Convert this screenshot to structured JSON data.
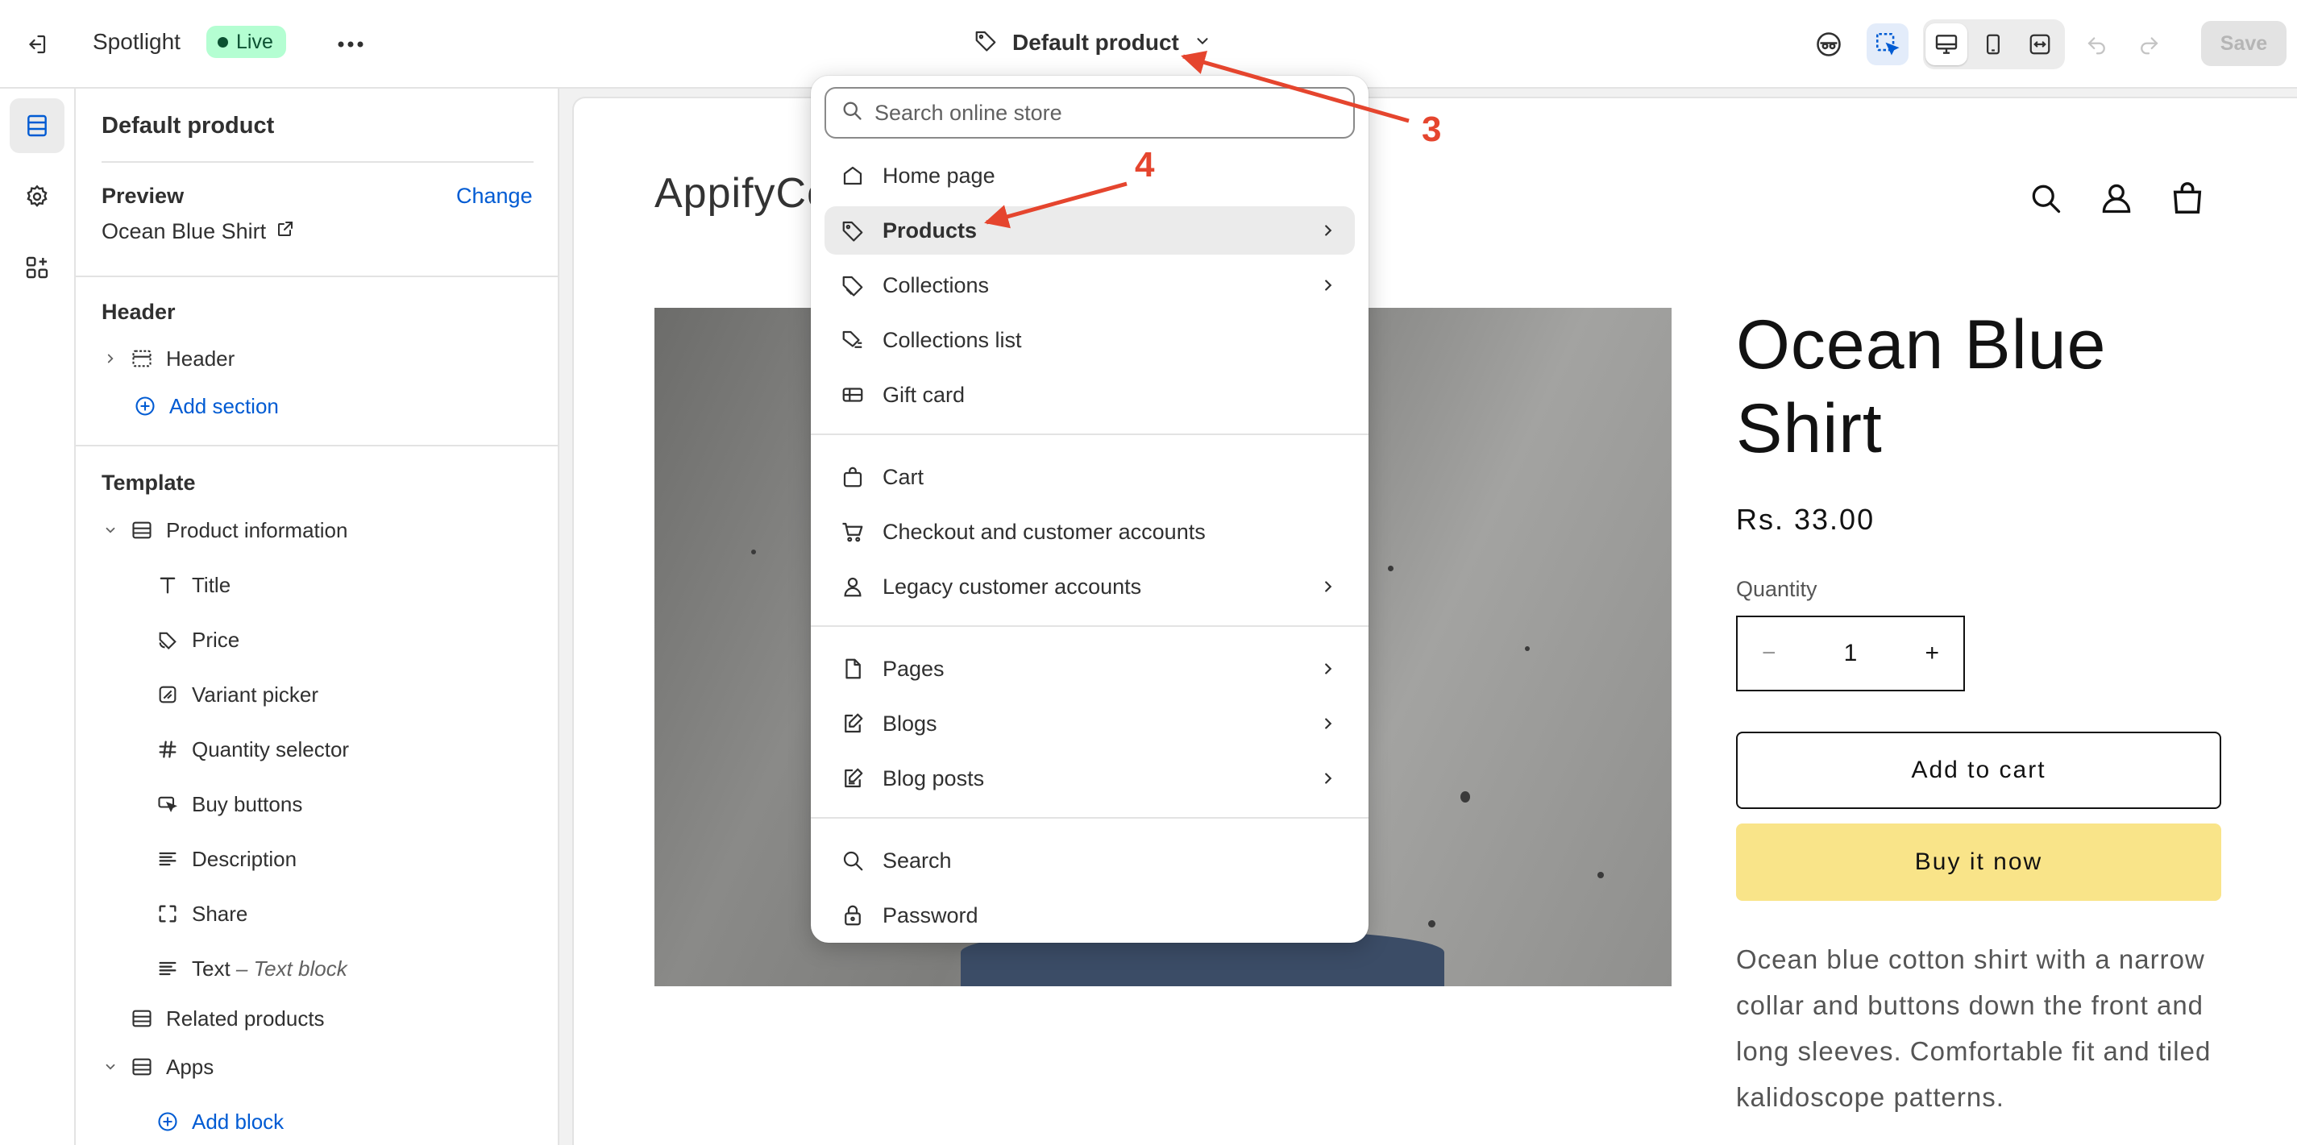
{
  "topbar": {
    "theme_name": "Spotlight",
    "live_label": "Live",
    "template_label": "Default product",
    "save_label": "Save"
  },
  "sidebar": {
    "title": "Default product",
    "preview_label": "Preview",
    "change_label": "Change",
    "preview_product": "Ocean Blue Shirt",
    "header_heading": "Header",
    "header_item": "Header",
    "add_section": "Add section",
    "template_heading": "Template",
    "product_information": "Product information",
    "blocks": {
      "title": "Title",
      "price": "Price",
      "variant_picker": "Variant picker",
      "quantity_selector": "Quantity selector",
      "buy_buttons": "Buy buttons",
      "description": "Description",
      "share": "Share",
      "text": "Text",
      "text_suffix": "– Text block"
    },
    "related_products": "Related products",
    "apps": "Apps",
    "add_block": "Add block"
  },
  "dropdown": {
    "search_placeholder": "Search online store",
    "items": [
      {
        "label": "Home page"
      },
      {
        "label": "Products"
      },
      {
        "label": "Collections"
      },
      {
        "label": "Collections list"
      },
      {
        "label": "Gift card"
      },
      {
        "label": "Cart"
      },
      {
        "label": "Checkout and customer accounts"
      },
      {
        "label": "Legacy customer accounts"
      },
      {
        "label": "Pages"
      },
      {
        "label": "Blogs"
      },
      {
        "label": "Blog posts"
      },
      {
        "label": "Search"
      },
      {
        "label": "Password"
      }
    ]
  },
  "store": {
    "logo": "AppifyCo",
    "product_title": "Ocean Blue Shirt",
    "price": "Rs. 33.00",
    "quantity_label": "Quantity",
    "quantity_value": "1",
    "qty_minus": "−",
    "qty_plus": "+",
    "add_to_cart": "Add to cart",
    "buy_now": "Buy it now",
    "description": "Ocean blue cotton shirt with a narrow collar and buttons down the front and long sleeves. Comfortable fit and tiled kalidoscope patterns."
  },
  "annotations": {
    "step3": "3",
    "step4": "4",
    "color": "#e5452e"
  },
  "colors": {
    "accent_link": "#005bd3",
    "live_bg": "#b4fed2",
    "buy_button": "#f9e489"
  }
}
